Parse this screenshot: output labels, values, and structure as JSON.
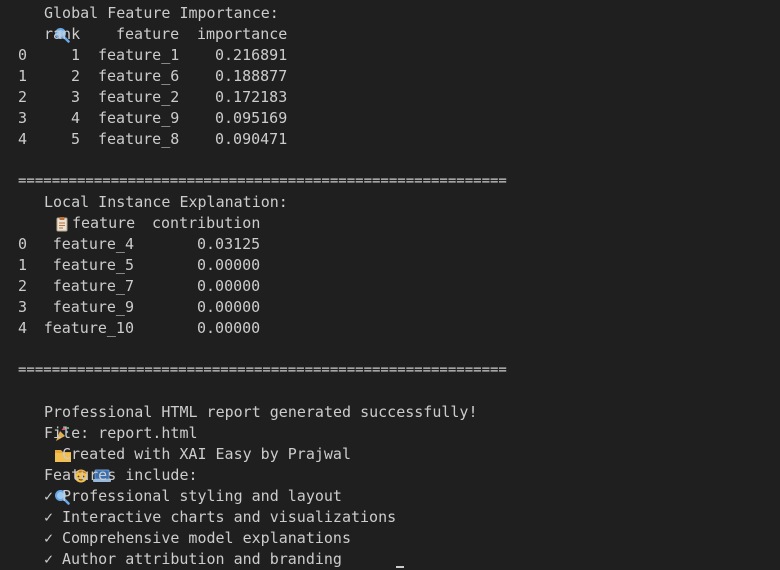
{
  "global": {
    "title": "Global Feature Importance:",
    "icon": "magnifier-icon",
    "headers": {
      "rank": "rank",
      "feature": "feature",
      "importance": "importance"
    },
    "rows": [
      {
        "idx": "0",
        "rank": "1",
        "feature": "feature_1",
        "importance": "0.216891"
      },
      {
        "idx": "1",
        "rank": "2",
        "feature": "feature_6",
        "importance": "0.188877"
      },
      {
        "idx": "2",
        "rank": "3",
        "feature": "feature_2",
        "importance": "0.172183"
      },
      {
        "idx": "3",
        "rank": "4",
        "feature": "feature_9",
        "importance": "0.095169"
      },
      {
        "idx": "4",
        "rank": "5",
        "feature": "feature_8",
        "importance": "0.090471"
      }
    ]
  },
  "separator": "==========================================================",
  "local": {
    "title": "Local Instance Explanation:",
    "icon": "clipboard-icon",
    "headers": {
      "feature": "feature",
      "contribution": "contribution"
    },
    "rows": [
      {
        "idx": "0",
        "feature": "feature_4",
        "contribution": "0.03125"
      },
      {
        "idx": "1",
        "feature": "feature_5",
        "contribution": "0.00000"
      },
      {
        "idx": "2",
        "feature": "feature_7",
        "contribution": "0.00000"
      },
      {
        "idx": "3",
        "feature": "feature_9",
        "contribution": "0.00000"
      },
      {
        "idx": "4",
        "feature": "feature_10",
        "contribution": "0.00000"
      }
    ]
  },
  "report": {
    "success": "Professional HTML report generated successfully!",
    "file": "File: report.html",
    "created": "Created with XAI Easy by Prajwal",
    "features_title": "Features include:",
    "check": "✓",
    "features": [
      "Professional styling and layout",
      "Interactive charts and visualizations",
      "Comprehensive model explanations",
      "Author attribution and branding"
    ]
  },
  "colors": {
    "background": "#1f1f1f",
    "text": "#cccccc",
    "folder": "#e8a83a",
    "magnifier": "#6aa8e8",
    "party": "#e0b050",
    "person": "#f2c14e",
    "laptop": "#6a9fd8"
  }
}
